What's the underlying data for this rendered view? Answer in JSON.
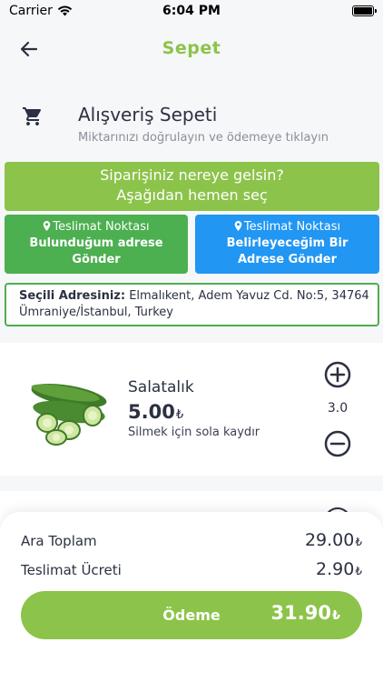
{
  "status_bar": {
    "carrier": "Carrier",
    "time": "6:04 PM"
  },
  "nav": {
    "title": "Sepet"
  },
  "cart": {
    "title": "Alışveriş Sepeti",
    "subtitle": "Miktarınızı doğrulayın ve ödemeye tıklayın"
  },
  "delivery": {
    "question_line1": "Siparişiniz nereye gelsin?",
    "question_line2": "Aşağıdan hemen seç",
    "option_current": {
      "line1": "Teslimat Noktası",
      "line2": "Bulunduğum adrese",
      "line3": "Gönder"
    },
    "option_custom": {
      "line1": "Teslimat Noktası",
      "line2": "Belirleyeceğim Bir",
      "line3": "Adrese Gönder"
    },
    "selected_label": "Seçili Adresiniz:",
    "selected_address_line1": "Elmalıkent, Adem Yavuz Cd. No:5, 34764",
    "selected_address_line2": "Ümraniye/İstanbul, Turkey"
  },
  "items": [
    {
      "name": "Salatalık",
      "price": "5.00",
      "currency": "₺",
      "hint": "Silmek için sola kaydır",
      "quantity": "3.0",
      "image_icon": "cucumber-image"
    }
  ],
  "summary": {
    "subtotal_label": "Ara Toplam",
    "subtotal": "29.00",
    "delivery_label": "Teslimat Ücreti",
    "delivery_fee": "2.90",
    "currency": "₺",
    "pay_label": "Ödeme",
    "total": "31.90"
  },
  "colors": {
    "accent": "#8cc34a",
    "green": "#4caf50",
    "blue": "#2196f3",
    "text": "#2b3142"
  }
}
